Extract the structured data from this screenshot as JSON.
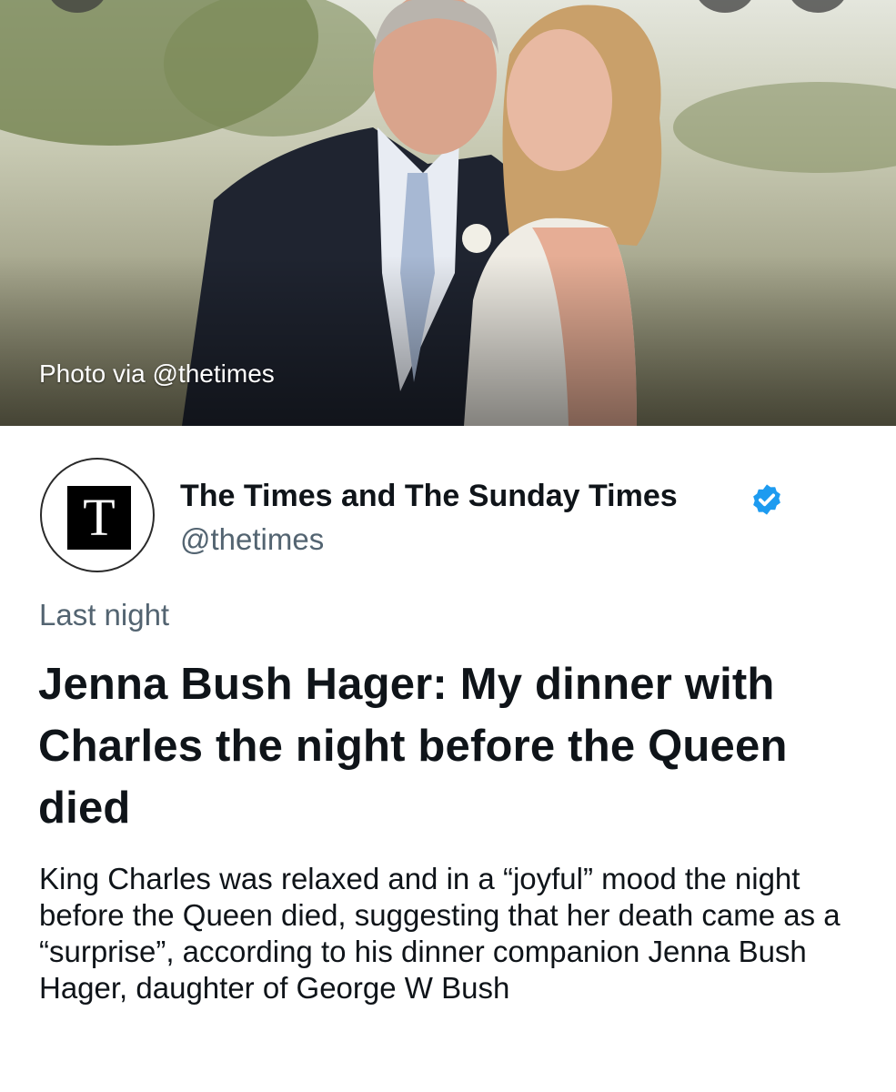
{
  "hero": {
    "caption": "Photo via @thetimes"
  },
  "account": {
    "logo_letter": "T",
    "display_name": "The Times and The Sunday Times",
    "handle": "@thetimes",
    "verified_icon": "verified-badge-icon"
  },
  "article": {
    "timestamp": "Last night",
    "headline": "Jenna Bush Hager: My dinner with Charles the night before the Queen died",
    "summary": "King Charles was relaxed and in a “joyful” mood the night before the Queen died, suggesting that her death came as a “surprise”, according to his dinner companion Jenna Bush Hager, daughter of George W Bush"
  },
  "colors": {
    "verified": "#1d9bf0",
    "secondary_text": "#536471",
    "primary_text": "#0f1419"
  }
}
